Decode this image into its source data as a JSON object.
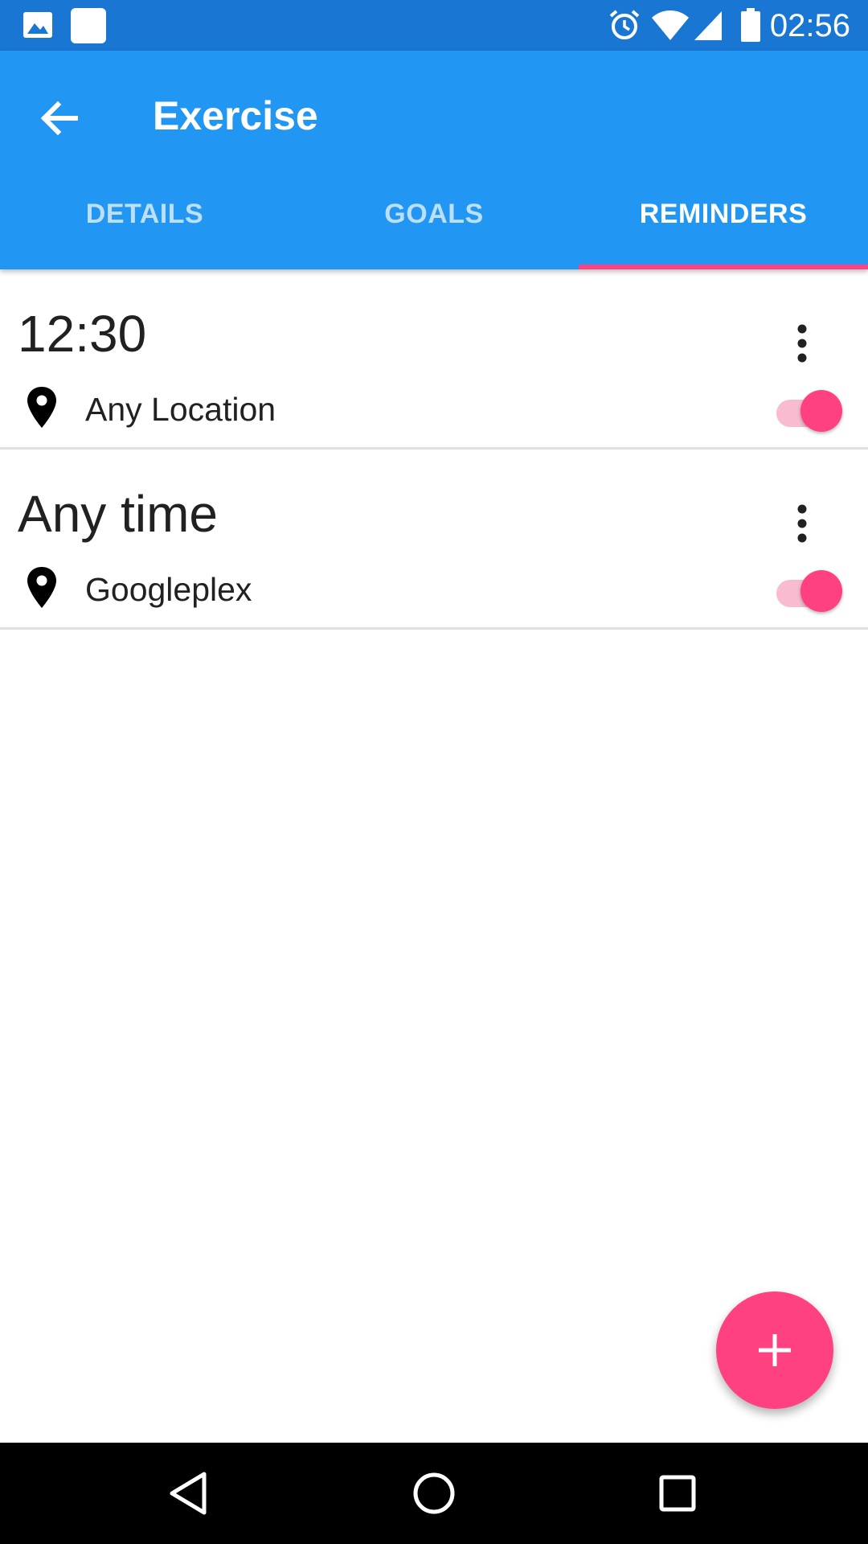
{
  "status_bar": {
    "time": "02:56",
    "left_icons": [
      "image-icon",
      "square-notification-icon"
    ],
    "right_icons": [
      "alarm-icon",
      "wifi-icon",
      "signal-icon",
      "battery-icon"
    ]
  },
  "app_bar": {
    "title": "Exercise",
    "back_icon": "arrow-back-icon"
  },
  "tabs": [
    {
      "label": "DETAILS",
      "active": false
    },
    {
      "label": "GOALS",
      "active": false
    },
    {
      "label": "REMINDERS",
      "active": true
    }
  ],
  "reminders": [
    {
      "time": "12:30",
      "location": "Any Location",
      "enabled": true
    },
    {
      "time": "Any time",
      "location": "Googleplex",
      "enabled": true
    }
  ],
  "fab": {
    "icon": "add-icon"
  },
  "nav_bar": {
    "icons": [
      "back-triangle-icon",
      "home-circle-icon",
      "recents-square-icon"
    ]
  },
  "colors": {
    "status_bar": "#1976d2",
    "app_bar": "#2196f3",
    "accent": "#ff4081",
    "switch_track": "#f8bbd0"
  }
}
